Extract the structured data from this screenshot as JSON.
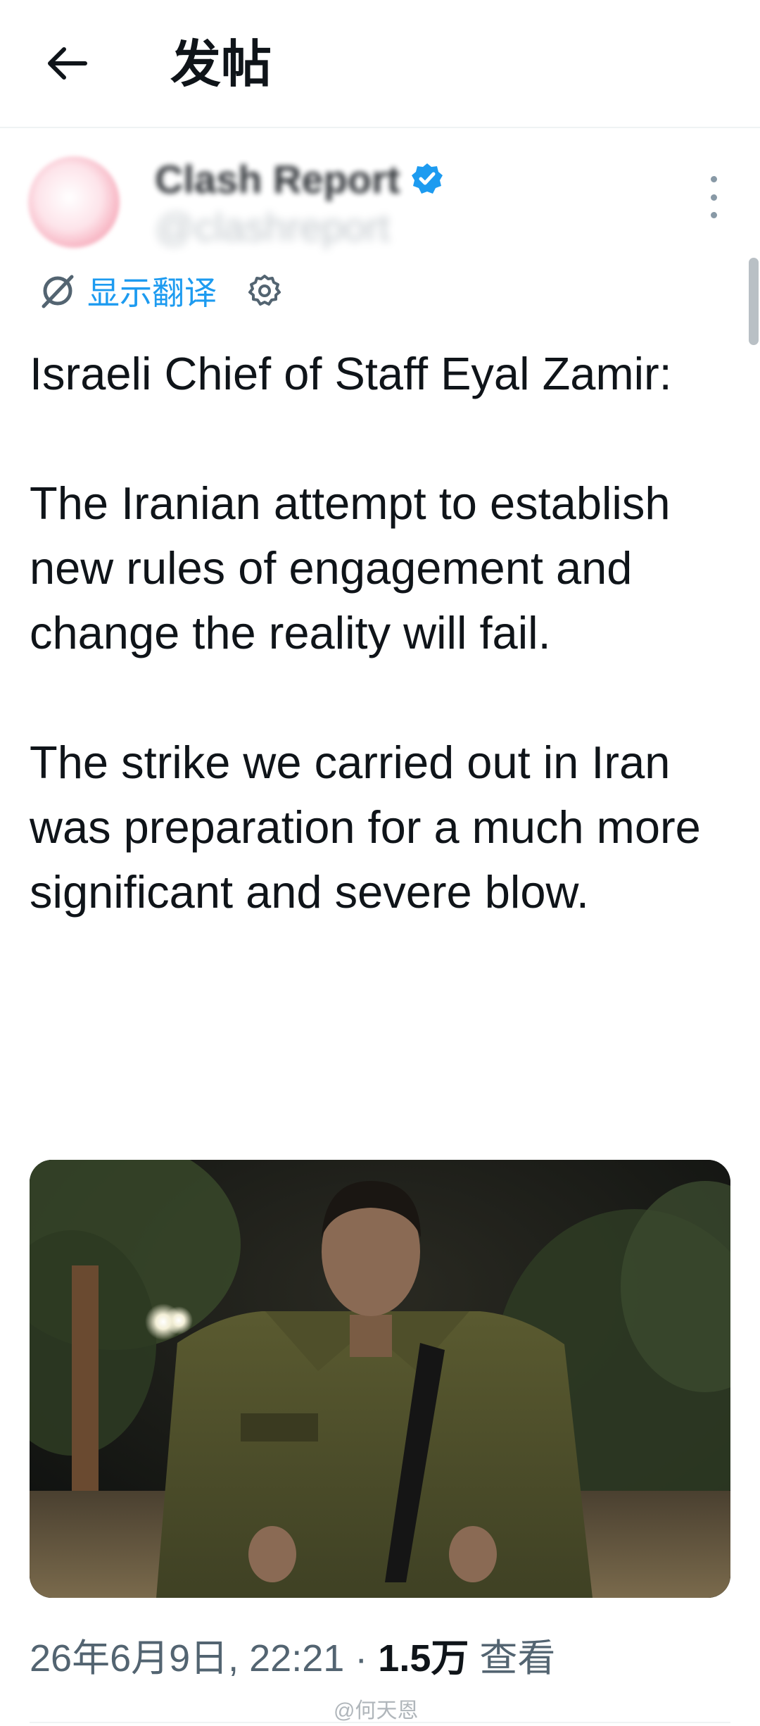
{
  "header": {
    "title": "发帖",
    "back_icon": "arrow-left-icon"
  },
  "post": {
    "author": {
      "display_name": "Clash Report",
      "handle": "@clashreport",
      "verified": true
    },
    "translate": {
      "label": "显示翻译",
      "icon": "translate-icon",
      "settings_icon": "gear-icon"
    },
    "text": [
      "Israeli Chief of Staff Eyal Zamir:",
      "The Iranian attempt to establish new rules of engagement and change the reality will fail.",
      "The strike we carried out in Iran was preparation for a much more significant and severe blow."
    ],
    "media": {
      "description_icon": "photo"
    },
    "meta": {
      "timestamp": "26年6月9日, 22:21",
      "separator": "·",
      "views_count": "1.5万",
      "views_label": "查看"
    }
  },
  "watermark": "@何天恩",
  "colors": {
    "accent": "#1d9bf0",
    "text_primary": "#0f1419",
    "text_secondary": "#536471"
  }
}
